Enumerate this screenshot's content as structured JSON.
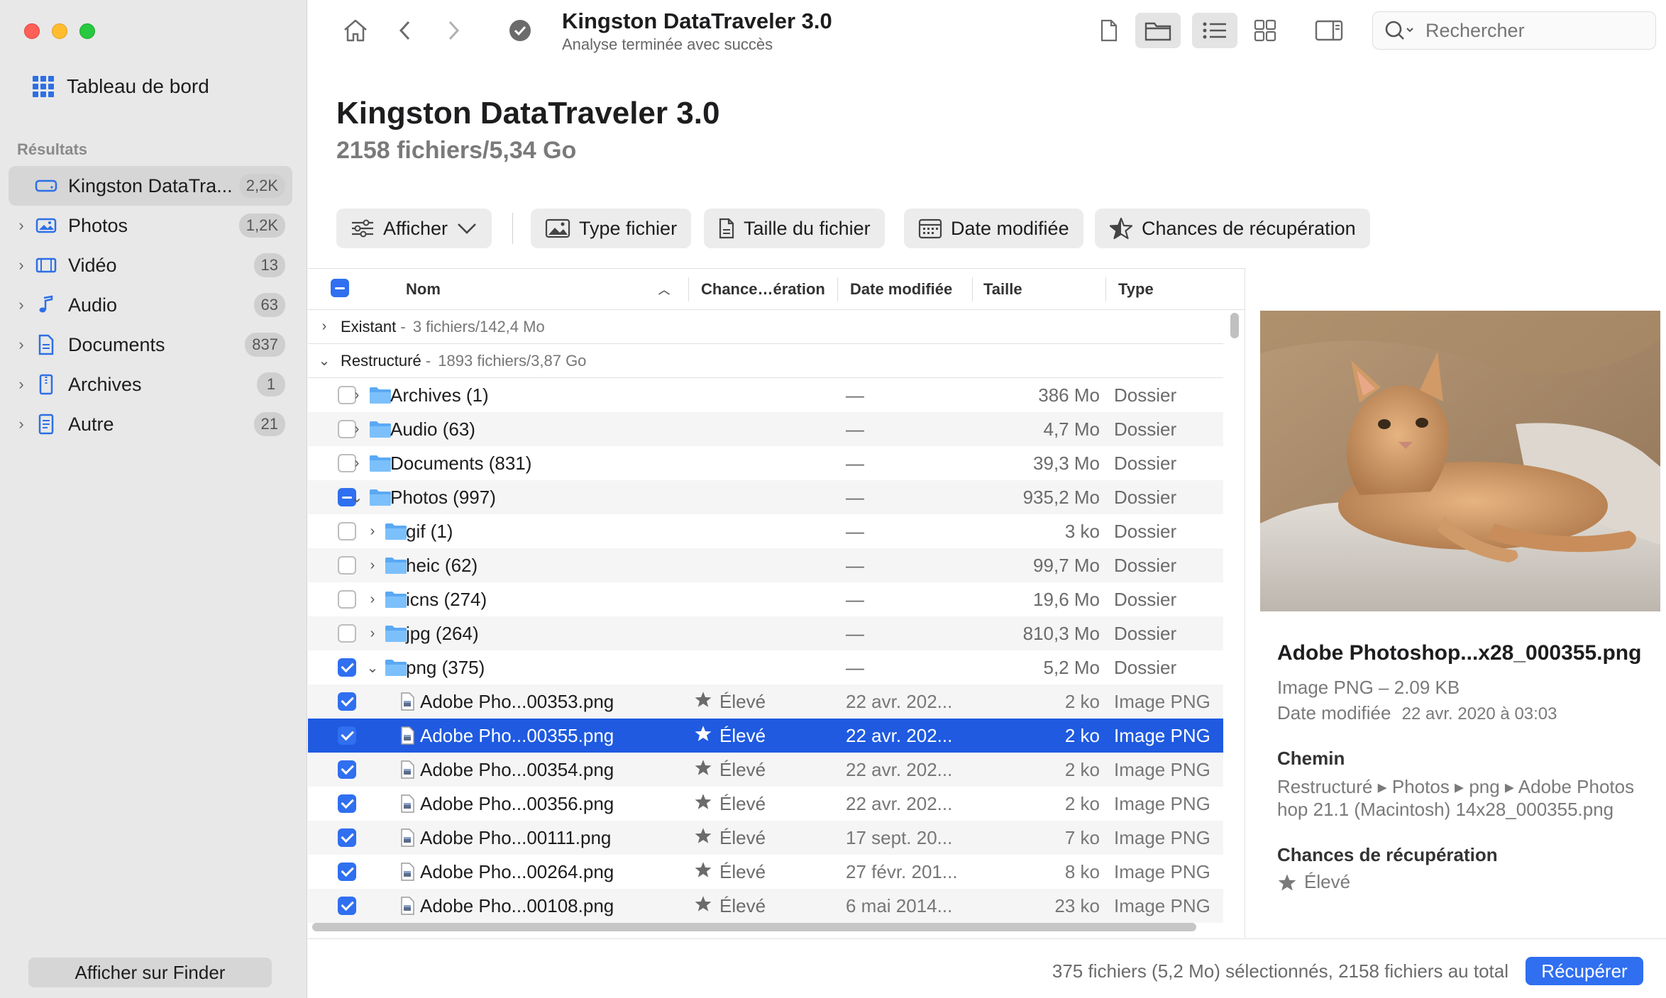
{
  "sidebar": {
    "dashboard_label": "Tableau de bord",
    "section_label": "Résultats",
    "items": [
      {
        "label": "Kingston DataTra...",
        "count": "2,2K",
        "icon": "drive-icon"
      },
      {
        "label": "Photos",
        "count": "1,2K",
        "icon": "photo-icon"
      },
      {
        "label": "Vidéo",
        "count": "13",
        "icon": "film-icon"
      },
      {
        "label": "Audio",
        "count": "63",
        "icon": "music-note-icon"
      },
      {
        "label": "Documents",
        "count": "837",
        "icon": "document-icon"
      },
      {
        "label": "Archives",
        "count": "1",
        "icon": "archive-icon"
      },
      {
        "label": "Autre",
        "count": "21",
        "icon": "other-file-icon"
      }
    ],
    "finder_button": "Afficher sur Finder"
  },
  "toolbar": {
    "title": "Kingston DataTraveler 3.0",
    "subtitle": "Analyse terminée avec succès",
    "search_placeholder": "Rechercher"
  },
  "header": {
    "title": "Kingston DataTraveler 3.0",
    "subtitle": "2158 fichiers/5,34 Go"
  },
  "filters": {
    "show": "Afficher",
    "file_type": "Type fichier",
    "file_size": "Taille du fichier",
    "date_modified": "Date modifiée",
    "recovery_chances": "Chances de récupération"
  },
  "table": {
    "columns": {
      "name": "Nom",
      "chance": "Chance…ération",
      "date": "Date modifiée",
      "size": "Taille",
      "type": "Type"
    },
    "groups": [
      {
        "label": "Existant",
        "detail": "3 fichiers/142,4 Mo"
      },
      {
        "label": "Restructuré",
        "detail": "1893 fichiers/3,87 Go"
      }
    ],
    "rows": [
      {
        "name": "Archives (1)",
        "chance": "",
        "date": "—",
        "size": "386 Mo",
        "type": "Dossier"
      },
      {
        "name": "Audio (63)",
        "chance": "",
        "date": "—",
        "size": "4,7 Mo",
        "type": "Dossier"
      },
      {
        "name": "Documents (831)",
        "chance": "",
        "date": "—",
        "size": "39,3 Mo",
        "type": "Dossier"
      },
      {
        "name": "Photos (997)",
        "chance": "",
        "date": "—",
        "size": "935,2 Mo",
        "type": "Dossier"
      },
      {
        "name": "gif (1)",
        "chance": "",
        "date": "—",
        "size": "3 ko",
        "type": "Dossier"
      },
      {
        "name": "heic (62)",
        "chance": "",
        "date": "—",
        "size": "99,7 Mo",
        "type": "Dossier"
      },
      {
        "name": "icns (274)",
        "chance": "",
        "date": "—",
        "size": "19,6 Mo",
        "type": "Dossier"
      },
      {
        "name": "jpg (264)",
        "chance": "",
        "date": "—",
        "size": "810,3 Mo",
        "type": "Dossier"
      },
      {
        "name": "png (375)",
        "chance": "",
        "date": "—",
        "size": "5,2 Mo",
        "type": "Dossier"
      },
      {
        "name": "Adobe Pho...00353.png",
        "chance": "Élevé",
        "date": "22 avr. 202...",
        "size": "2 ko",
        "type": "Image PNG"
      },
      {
        "name": "Adobe Pho...00355.png",
        "chance": "Élevé",
        "date": "22 avr. 202...",
        "size": "2 ko",
        "type": "Image PNG"
      },
      {
        "name": "Adobe Pho...00354.png",
        "chance": "Élevé",
        "date": "22 avr. 202...",
        "size": "2 ko",
        "type": "Image PNG"
      },
      {
        "name": "Adobe Pho...00356.png",
        "chance": "Élevé",
        "date": "22 avr. 202...",
        "size": "2 ko",
        "type": "Image PNG"
      },
      {
        "name": "Adobe Pho...00111.png",
        "chance": "Élevé",
        "date": "17 sept. 20...",
        "size": "7 ko",
        "type": "Image PNG"
      },
      {
        "name": "Adobe Pho...00264.png",
        "chance": "Élevé",
        "date": "27 févr. 201...",
        "size": "8 ko",
        "type": "Image PNG"
      },
      {
        "name": "Adobe Pho...00108.png",
        "chance": "Élevé",
        "date": "6 mai 2014...",
        "size": "23 ko",
        "type": "Image PNG"
      }
    ]
  },
  "preview": {
    "file_name": "Adobe Photoshop...x28_000355.png",
    "file_kind": "Image PNG – 2.09 KB",
    "date_label": "Date modifiée",
    "date_value": "22 avr. 2020 à 03:03",
    "path_heading": "Chemin",
    "path_line1": "Restructuré ▸ Photos ▸ png ▸ Adobe Photos",
    "path_line2": "hop 21.1 (Macintosh) 14x28_000355.png",
    "chance_heading": "Chances de récupération",
    "chance_value": "Élevé"
  },
  "footer": {
    "status": "375 fichiers (5,2 Mo) sélectionnés, 2158 fichiers au total",
    "recover_button": "Récupérer"
  },
  "colors": {
    "accent": "#2f6ff0",
    "selection": "#1f5ae0",
    "folder": "#5aa9f5"
  }
}
